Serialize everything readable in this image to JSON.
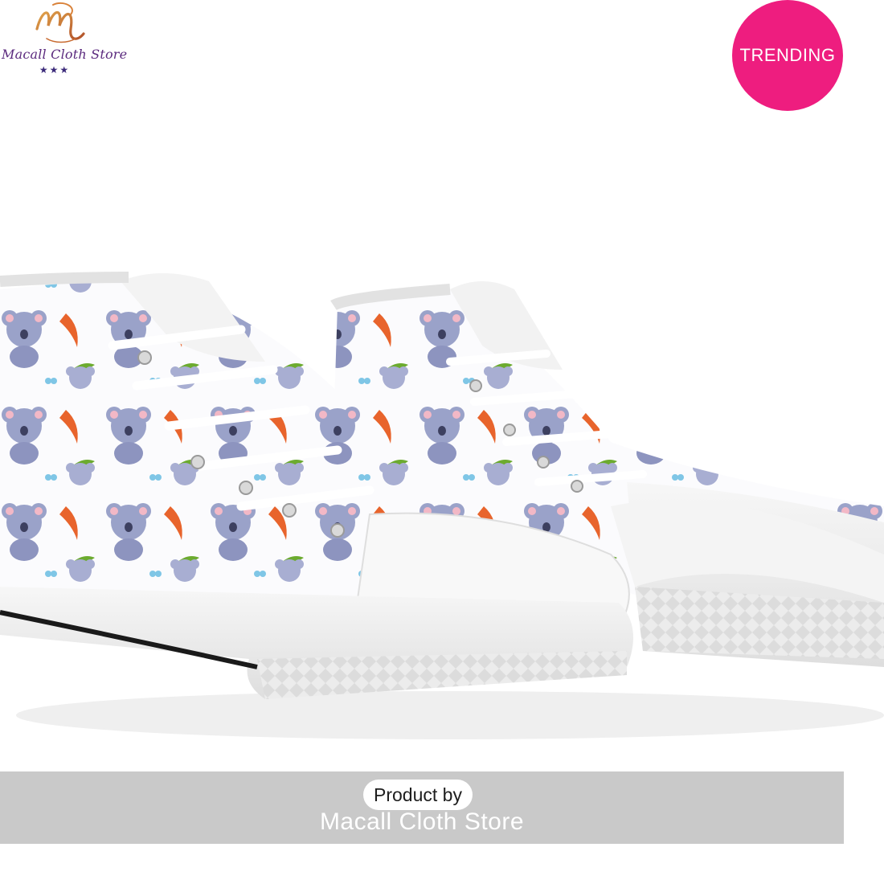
{
  "logo": {
    "name": "Macall Cloth Store",
    "stars": "★★★",
    "icon": "m-monogram-logo"
  },
  "badge": {
    "label": "TRENDING",
    "color": "#ee1d7f"
  },
  "product": {
    "image": "koala-print-high-top-sneakers",
    "colors": {
      "canvas": "#ffffff",
      "koala": "#9aa2c9",
      "boomerang": "#e8642c",
      "leaf": "#6cab2f"
    }
  },
  "footer": {
    "label": "Product by",
    "store": "Macall Cloth Store",
    "bar_color": "#c9c9c9"
  }
}
